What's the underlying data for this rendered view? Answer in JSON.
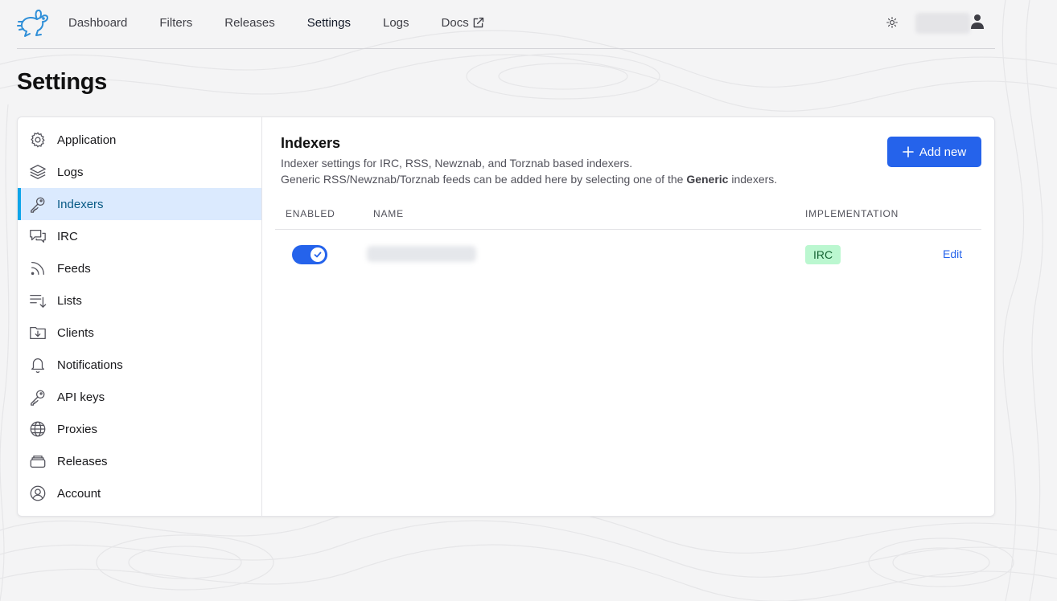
{
  "nav": {
    "items": [
      {
        "label": "Dashboard"
      },
      {
        "label": "Filters"
      },
      {
        "label": "Releases"
      },
      {
        "label": "Settings"
      },
      {
        "label": "Logs"
      },
      {
        "label": "Docs"
      }
    ],
    "active": "Settings"
  },
  "page": {
    "title": "Settings"
  },
  "sidebar": {
    "active": "Indexers",
    "items": [
      {
        "label": "Application",
        "icon": "gear-icon"
      },
      {
        "label": "Logs",
        "icon": "layers-icon"
      },
      {
        "label": "Indexers",
        "icon": "key-icon"
      },
      {
        "label": "IRC",
        "icon": "chat-icon"
      },
      {
        "label": "Feeds",
        "icon": "rss-icon"
      },
      {
        "label": "Lists",
        "icon": "list-icon"
      },
      {
        "label": "Clients",
        "icon": "folder-download-icon"
      },
      {
        "label": "Notifications",
        "icon": "bell-icon"
      },
      {
        "label": "API keys",
        "icon": "key-icon"
      },
      {
        "label": "Proxies",
        "icon": "globe-icon"
      },
      {
        "label": "Releases",
        "icon": "stack-icon"
      },
      {
        "label": "Account",
        "icon": "user-circle-icon"
      }
    ]
  },
  "indexers": {
    "title": "Indexers",
    "desc_line1": "Indexer settings for IRC, RSS, Newznab, and Torznab based indexers.",
    "desc_line2_pre": "Generic RSS/Newznab/Torznab feeds can be added here by selecting one of the ",
    "desc_line2_bold": "Generic",
    "desc_line2_post": " indexers.",
    "add_label": "Add new",
    "columns": {
      "enabled": "Enabled",
      "name": "Name",
      "implementation": "Implementation"
    },
    "rows": [
      {
        "enabled": true,
        "implementation": "IRC",
        "action": "Edit"
      }
    ]
  },
  "colors": {
    "accent": "#2563eb",
    "active_bg": "#dbeafe",
    "active_bar": "#0ea5e9",
    "badge_bg": "#bbf7d0"
  }
}
